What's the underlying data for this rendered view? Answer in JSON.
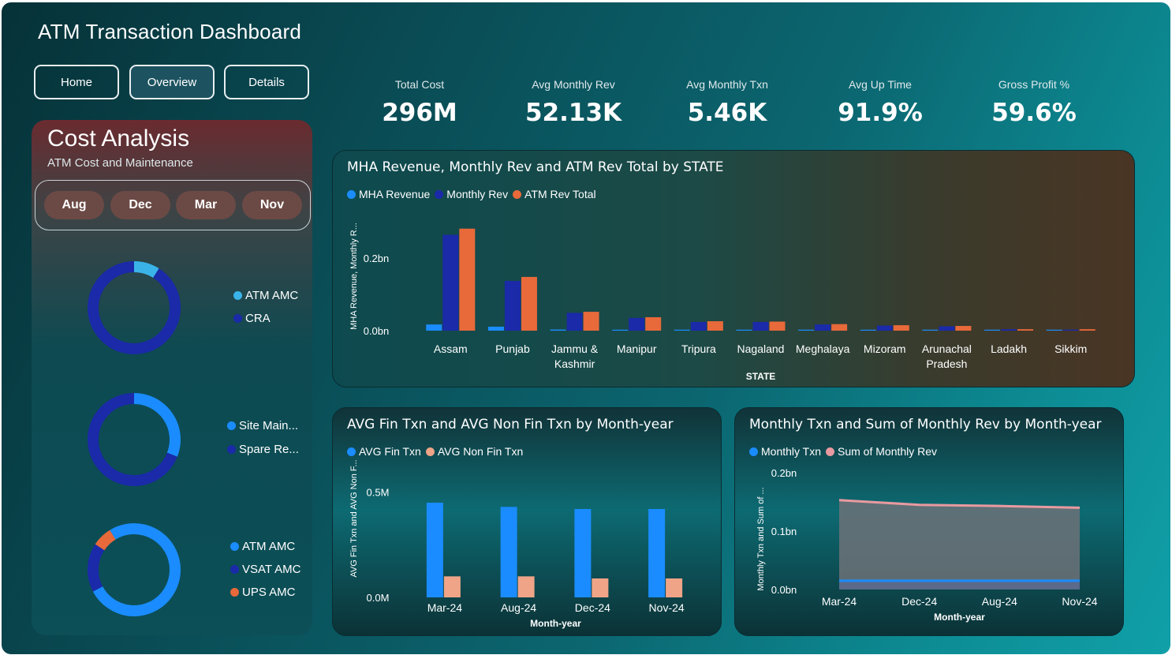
{
  "app": {
    "title": "ATM Transaction Dashboard"
  },
  "nav": [
    {
      "label": "Home",
      "active": false
    },
    {
      "label": "Overview",
      "active": true
    },
    {
      "label": "Details",
      "active": false
    }
  ],
  "kpis": [
    {
      "label": "Total Cost",
      "value": "296M"
    },
    {
      "label": "Avg Monthly Rev",
      "value": "52.13K"
    },
    {
      "label": "Avg Monthly Txn",
      "value": "5.46K"
    },
    {
      "label": "Avg Up Time",
      "value": "91.9%"
    },
    {
      "label": "Gross Profit %",
      "value": "59.6%"
    }
  ],
  "cost_panel": {
    "title": "Cost Analysis",
    "subtitle": "ATM Cost and Maintenance",
    "months": [
      "Aug",
      "Dec",
      "Mar",
      "Nov"
    ]
  },
  "colors": {
    "light_blue": "#3ab4e8",
    "blue": "#1a8cff",
    "dark_blue": "#1a2aa8",
    "orange": "#e8693a",
    "peach": "#efa487",
    "pink": "#e89aa0"
  },
  "donuts": [
    {
      "legend": [
        {
          "label": "ATM AMC",
          "color": "#3ab4e8"
        },
        {
          "label": "CRA",
          "color": "#1a2aa8"
        }
      ],
      "fractions": [
        0.09,
        0.91
      ]
    },
    {
      "legend": [
        {
          "label": "Site Main...",
          "color": "#1a8cff"
        },
        {
          "label": "Spare Re...",
          "color": "#1a2aa8"
        }
      ],
      "fractions": [
        0.31,
        0.69
      ]
    },
    {
      "legend": [
        {
          "label": "ATM AMC",
          "color": "#1a8cff"
        },
        {
          "label": "VSAT AMC",
          "color": "#1a2aa8"
        },
        {
          "label": "UPS AMC",
          "color": "#e8693a"
        }
      ],
      "fractions": [
        0.76,
        0.17,
        0.07
      ]
    }
  ],
  "chart_data": [
    {
      "type": "bar",
      "title": "MHA Revenue, Monthly Rev and ATM Rev Total by STATE",
      "xlabel": "STATE",
      "ylabel": "MHA Revenue, Monthly R...",
      "yticks": [
        "0.2bn",
        "0.0bn"
      ],
      "ylim": [
        0,
        0.3
      ],
      "categories": [
        "Assam",
        "Punjab",
        "Jammu & Kashmir",
        "Manipur",
        "Tripura",
        "Nagaland",
        "Meghalaya",
        "Mizoram",
        "Arunachal Pradesh",
        "Ladakh",
        "Sikkim"
      ],
      "series": [
        {
          "name": "MHA Revenue",
          "color": "#1a8cff",
          "values": [
            0.017,
            0.011,
            0.003,
            0.002,
            0.002,
            0.002,
            0.001,
            0.001,
            0.001,
            0.0005,
            0.0005
          ]
        },
        {
          "name": "Monthly Rev",
          "color": "#1a2aa8",
          "values": [
            0.264,
            0.137,
            0.049,
            0.035,
            0.024,
            0.024,
            0.017,
            0.014,
            0.012,
            0.004,
            0.003
          ]
        },
        {
          "name": "ATM Rev Total",
          "color": "#e8693a",
          "values": [
            0.281,
            0.148,
            0.052,
            0.037,
            0.026,
            0.025,
            0.018,
            0.015,
            0.013,
            0.004,
            0.004
          ]
        }
      ]
    },
    {
      "type": "bar",
      "title": "AVG Fin Txn and AVG Non Fin Txn by Month-year",
      "xlabel": "Month-year",
      "ylabel": "AVG Fin Txn and AVG Non F...",
      "yticks": [
        "0.5M",
        "0.0M"
      ],
      "ylim": [
        0,
        0.6
      ],
      "categories": [
        "Mar-24",
        "Aug-24",
        "Dec-24",
        "Nov-24"
      ],
      "series": [
        {
          "name": "AVG Fin Txn",
          "color": "#1a8cff",
          "values": [
            0.45,
            0.43,
            0.42,
            0.42
          ]
        },
        {
          "name": "AVG Non Fin Txn",
          "color": "#efa487",
          "values": [
            0.1,
            0.1,
            0.09,
            0.09
          ]
        }
      ]
    },
    {
      "type": "area",
      "title": "Monthly Txn and Sum of Monthly Rev by Month-year",
      "xlabel": "Month-year",
      "ylabel": "Monthly Txn and Sum of ...",
      "yticks": [
        "0.2bn",
        "0.1bn",
        "0.0bn"
      ],
      "ylim": [
        0,
        0.2
      ],
      "categories": [
        "Mar-24",
        "Dec-24",
        "Aug-24",
        "Nov-24"
      ],
      "series": [
        {
          "name": "Monthly Txn",
          "color": "#1a8cff",
          "values": [
            0.015,
            0.015,
            0.015,
            0.015
          ]
        },
        {
          "name": "Sum of Monthly Rev",
          "color": "#e89aa0",
          "values": [
            0.153,
            0.145,
            0.143,
            0.14
          ]
        }
      ]
    }
  ]
}
